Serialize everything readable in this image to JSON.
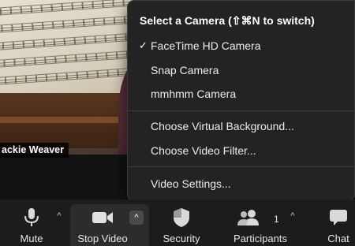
{
  "video": {
    "participant_name": "ackie Weaver"
  },
  "camera_menu": {
    "header": "Select a Camera (⇧⌘N to switch)",
    "check_glyph": "✓",
    "cameras": [
      {
        "label": "FaceTime HD Camera",
        "selected": true
      },
      {
        "label": "Snap Camera",
        "selected": false
      },
      {
        "label": "mmhmm Camera",
        "selected": false
      }
    ],
    "background_items": [
      {
        "label": "Choose Virtual Background..."
      },
      {
        "label": "Choose Video Filter..."
      }
    ],
    "settings_items": [
      {
        "label": "Video Settings..."
      }
    ]
  },
  "toolbar": {
    "mute_label": "Mute",
    "stop_video_label": "Stop Video",
    "security_label": "Security",
    "participants_label": "Participants",
    "participants_count": "1",
    "chat_label": "Chat",
    "caret_glyph": "^"
  },
  "icons": {
    "mic": "microphone-icon",
    "video": "video-camera-icon",
    "security": "shield-icon",
    "participants": "people-icon",
    "chat": "chat-bubble-icon"
  },
  "colors": {
    "menu_bg": "#232323",
    "toolbar_bg": "#1c1c1c",
    "active_caret_bg": "#4a4a4a"
  }
}
